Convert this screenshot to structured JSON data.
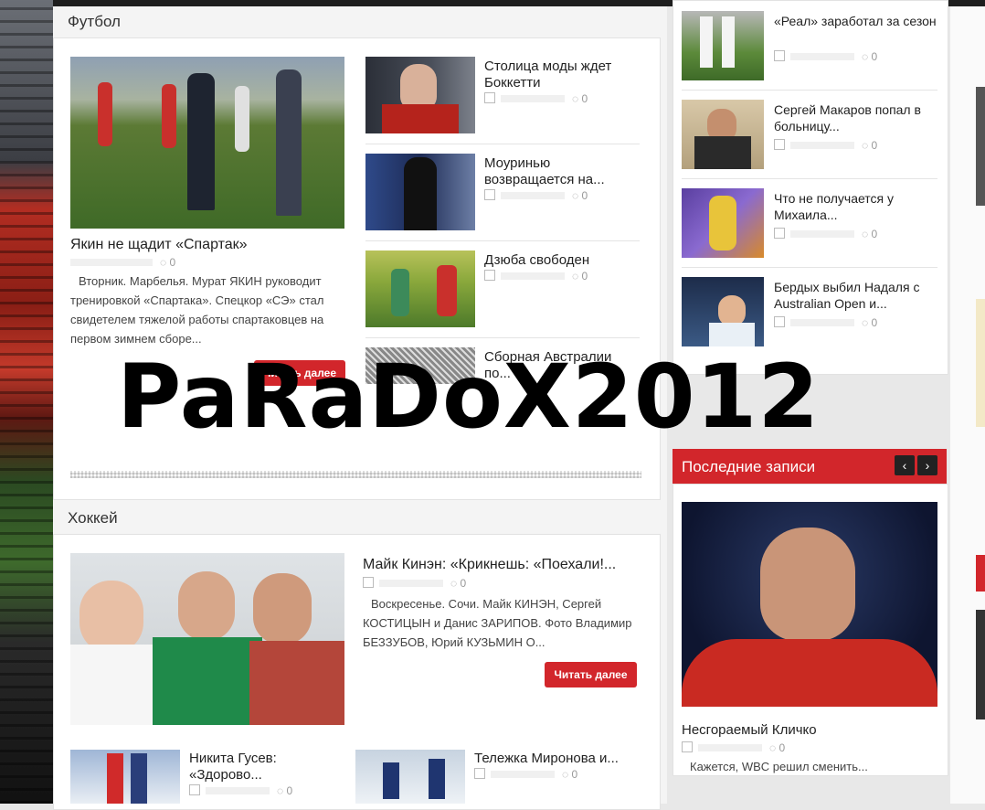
{
  "football": {
    "heading": "Футбол",
    "featured": {
      "title": "Якин не щадит «Спартак»",
      "comments": "0",
      "excerpt": "Вторник. Марбелья. Мурат ЯКИН руководит тренировкой «Спартака». Спецкор «СЭ» стал свидетелем тяжелой работы спартаковцев на первом зимнем сборе...",
      "read_more": "Читать далее"
    },
    "items": [
      {
        "title": "Столица моды ждет Боккетти",
        "comments": "0"
      },
      {
        "title": "Моуринью возвращается на...",
        "comments": "0"
      },
      {
        "title": "Дзюба свободен",
        "comments": "0"
      },
      {
        "title": "Сборная Австралии по...",
        "comments": ""
      }
    ]
  },
  "hockey": {
    "heading": "Хоккей",
    "featured": {
      "title": "Майк Кинэн: «Крикнешь: «Поехали!...",
      "comments": "0",
      "excerpt": "Воскресенье. Сочи. Майк КИНЭН, Сергей КОСТИЦЫН и Данис ЗАРИПОВ. Фото Владимир БЕЗЗУБОВ, Юрий КУЗЬМИН О...",
      "read_more": "Читать далее"
    },
    "items": [
      {
        "title": "Никита Гусев: «Здорово...",
        "comments": "0"
      },
      {
        "title": "Тележка Миронова и...",
        "comments": "0"
      }
    ]
  },
  "sidebar_news": [
    {
      "title": "«Реал» заработал за сезон",
      "comments": "0"
    },
    {
      "title": "Сергей Макаров попал в больницу...",
      "comments": "0"
    },
    {
      "title": "Что не получается у Михаила...",
      "comments": "0"
    },
    {
      "title": "Бердых выбил Надаля с Australian Open и...",
      "comments": "0"
    }
  ],
  "recent": {
    "heading": "Последние записи",
    "prev_icon": "‹",
    "next_icon": "›",
    "post": {
      "title": "Несгораемый Кличко",
      "comments": "0",
      "excerpt": "Кажется, WBC решил сменить..."
    }
  },
  "watermark": "PaRaDoX2012",
  "colors": {
    "accent": "#d2262b",
    "topbar": "#1e1e1e"
  }
}
